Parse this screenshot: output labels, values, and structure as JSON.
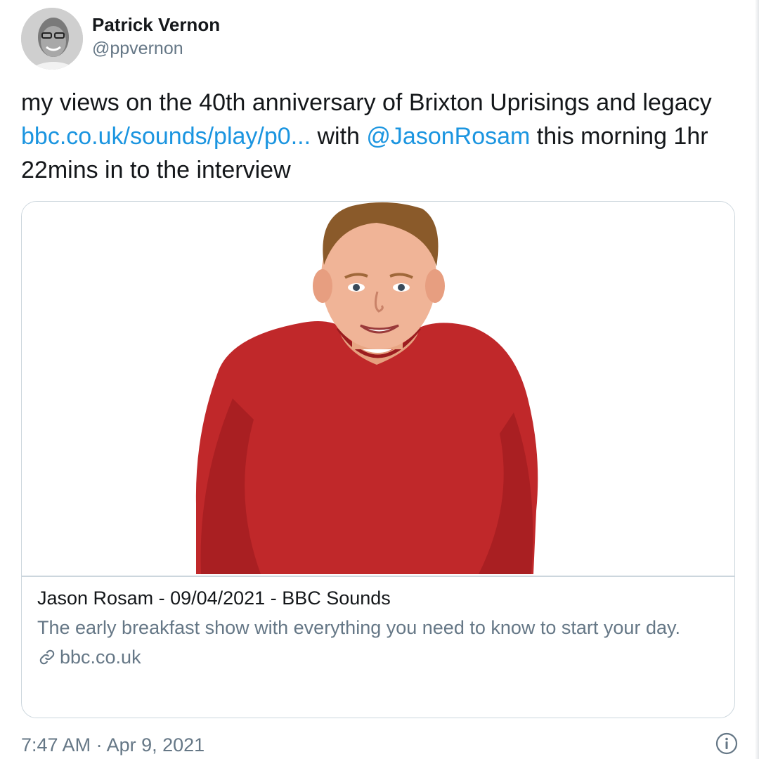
{
  "author": {
    "display_name": "Patrick Vernon",
    "handle": "@ppvernon"
  },
  "tweet": {
    "text_part1": "my views on the 40th anniversary of Brixton Uprisings and legacy ",
    "link_text": "bbc.co.uk/sounds/play/p0...",
    "text_part2": " with ",
    "mention": "@JasonRosam",
    "text_part3": " this morning 1hr 22mins in to the interview"
  },
  "card": {
    "image_icon": "person-photo",
    "title": "Jason Rosam - 09/04/2021 - BBC Sounds",
    "description": "The early breakfast show with everything you need to know to start your day.",
    "domain": "bbc.co.uk",
    "domain_icon": "link-icon"
  },
  "footer": {
    "timestamp": "7:47 AM · Apr 9, 2021",
    "info_icon": "info-icon"
  },
  "colors": {
    "link": "#1b95e0",
    "secondary_text": "#657786",
    "primary_text": "#14171a",
    "border": "#ccd6dd",
    "shirt": "#c0282a"
  }
}
